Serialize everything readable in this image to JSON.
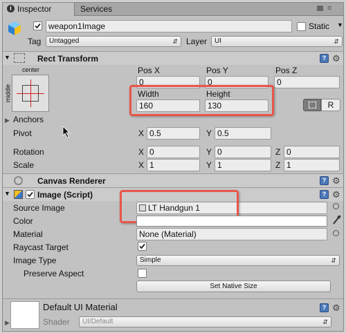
{
  "tabs": {
    "inspector": "Inspector",
    "services": "Services"
  },
  "object": {
    "name": "weapon1Image",
    "static_label": "Static",
    "tag_label": "Tag",
    "tag_value": "Untagged",
    "layer_label": "Layer",
    "layer_value": "UI"
  },
  "rect_transform": {
    "title": "Rect Transform",
    "anchor_preset_top": "center",
    "anchor_preset_side": "middle",
    "pos_x_label": "Pos X",
    "pos_x": "0",
    "pos_y_label": "Pos Y",
    "pos_y": "0",
    "pos_z_label": "Pos Z",
    "pos_z": "0",
    "width_label": "Width",
    "width": "160",
    "height_label": "Height",
    "height": "130",
    "raw_label": "R",
    "anchors_label": "Anchors",
    "pivot_label": "Pivot",
    "pivot_x": "0.5",
    "pivot_y": "0.5",
    "rotation_label": "Rotation",
    "rot_x": "0",
    "rot_y": "0",
    "rot_z": "0",
    "scale_label": "Scale",
    "scale_x": "1",
    "scale_y": "1",
    "scale_z": "1",
    "x": "X",
    "y": "Y",
    "z": "Z"
  },
  "canvas_renderer": {
    "title": "Canvas Renderer"
  },
  "image_script": {
    "title": "Image (Script)",
    "source_image_label": "Source Image",
    "source_image": "LT Handgun 1",
    "color_label": "Color",
    "material_label": "Material",
    "material": "None (Material)",
    "raycast_label": "Raycast Target",
    "image_type_label": "Image Type",
    "image_type": "Simple",
    "preserve_aspect_label": "Preserve Aspect",
    "set_native_size": "Set Native Size"
  },
  "material_footer": {
    "name": "Default UI Material",
    "shader_label": "Shader",
    "shader_value": "UI/Default"
  },
  "colors": {
    "highlight": "#e8564a",
    "panel": "#c2c2c2",
    "field": "#ececec"
  }
}
